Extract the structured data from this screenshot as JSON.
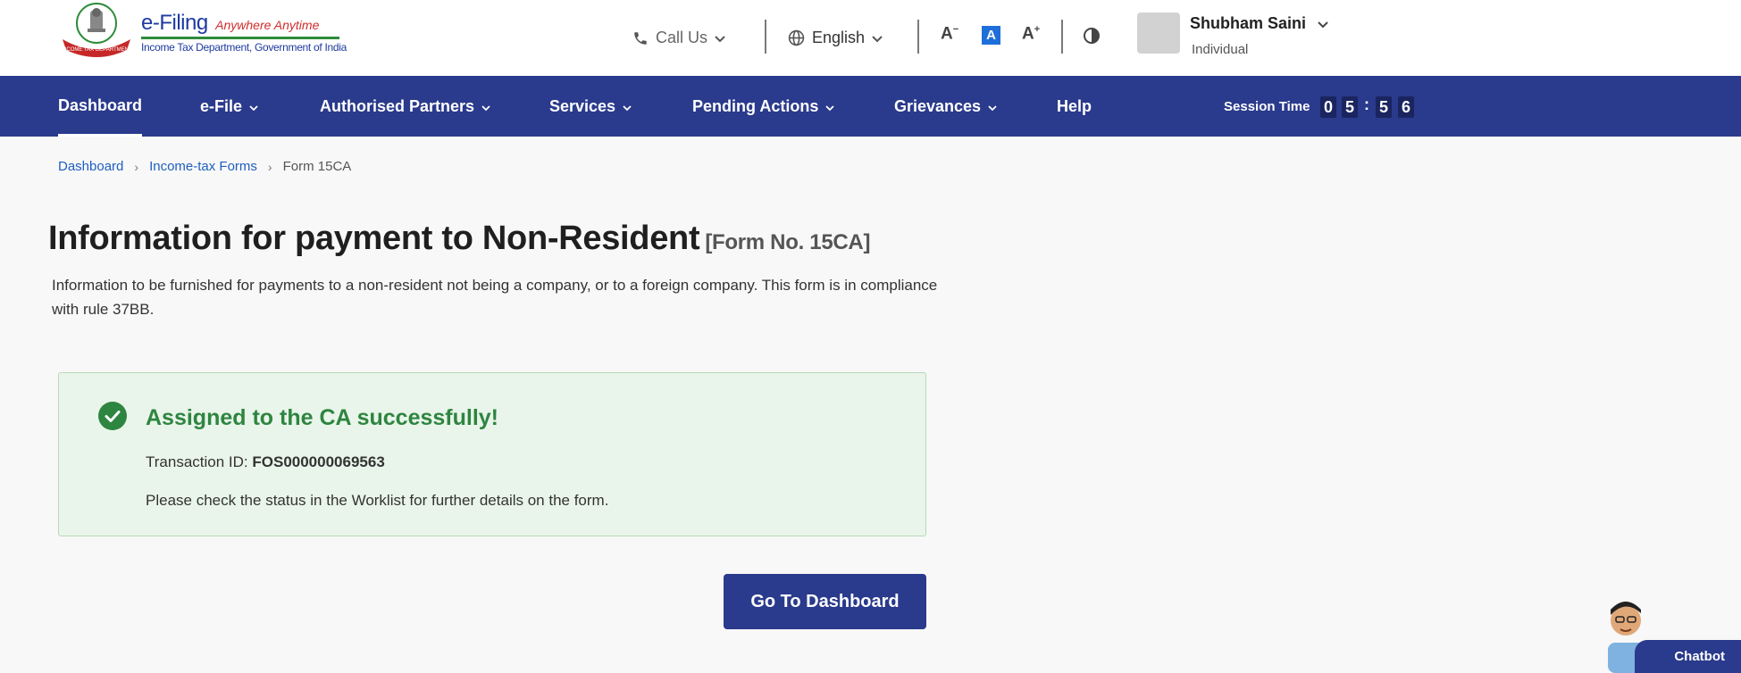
{
  "header": {
    "brand_main": "e-Filing",
    "brand_tagline": "Anywhere Anytime",
    "brand_sub": "Income Tax Department, Government of India",
    "emblem_ribbon_text": "INCOME TAX DEPARTMENT",
    "call_us": "Call Us",
    "language": "English",
    "font_decrease": "A",
    "font_default": "A",
    "font_increase": "A",
    "user": {
      "name": "Shubham Saini",
      "role": "Individual"
    }
  },
  "nav": {
    "items": [
      {
        "label": "Dashboard",
        "has_dropdown": false,
        "active": true
      },
      {
        "label": "e-File",
        "has_dropdown": true
      },
      {
        "label": "Authorised Partners",
        "has_dropdown": true
      },
      {
        "label": "Services",
        "has_dropdown": true
      },
      {
        "label": "Pending Actions",
        "has_dropdown": true
      },
      {
        "label": "Grievances",
        "has_dropdown": true
      },
      {
        "label": "Help",
        "has_dropdown": false
      }
    ],
    "session_label": "Session Time",
    "session_digits": [
      "0",
      "5",
      "5",
      "6"
    ]
  },
  "breadcrumb": {
    "items": [
      "Dashboard",
      "Income-tax Forms",
      "Form 15CA"
    ]
  },
  "page": {
    "title": "Information for payment to Non-Resident",
    "form_no": "[Form No. 15CA]",
    "description": "Information to be furnished for payments to a non-resident not being a company, or to a foreign company. This form is in compliance with rule 37BB."
  },
  "success": {
    "title": "Assigned to the CA successfully!",
    "txn_label": "Transaction ID:",
    "txn_id": "FOS000000069563",
    "note": "Please check the status in the Worklist for further details on the form."
  },
  "actions": {
    "go_dashboard": "Go To Dashboard"
  },
  "chatbot": {
    "label": "Chatbot"
  },
  "colors": {
    "nav_bg": "#2a3a8c",
    "success_green": "#2e8540",
    "success_bg": "#e9f5ea",
    "link_blue": "#1f5fbf"
  }
}
